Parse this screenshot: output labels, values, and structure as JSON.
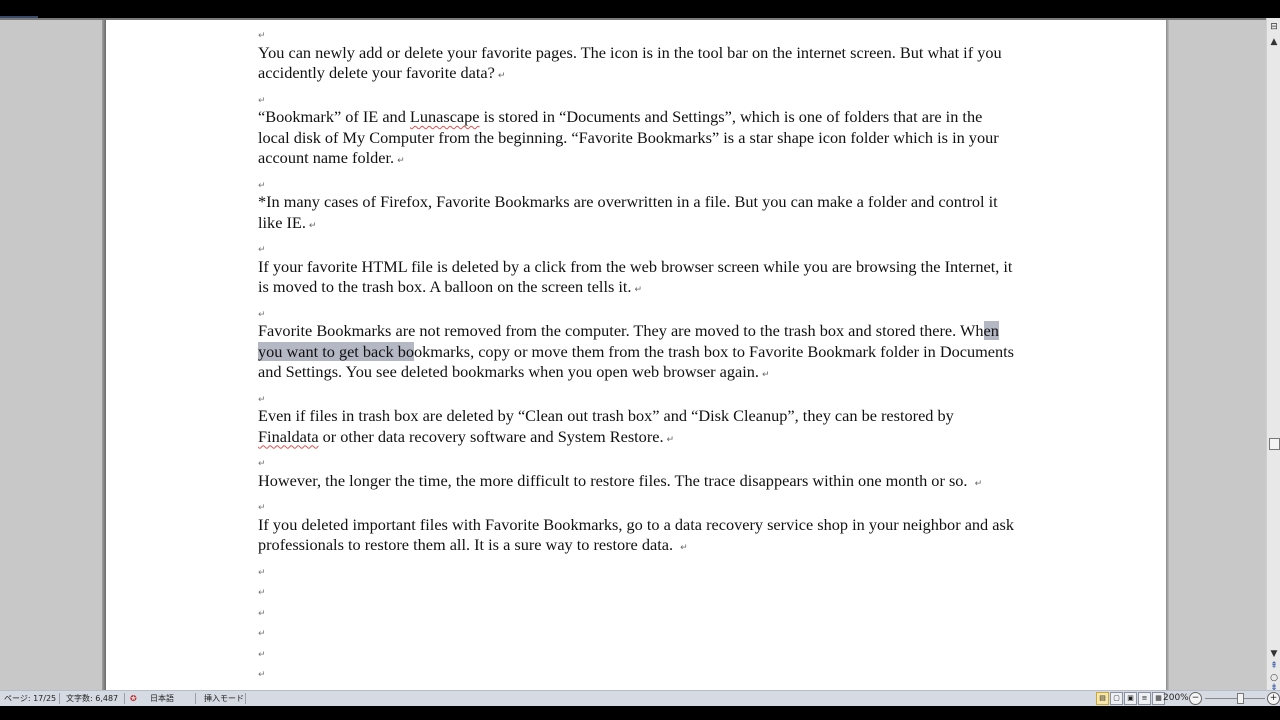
{
  "document": {
    "paragraph_mark": "↵",
    "paragraphs": [
      {
        "text": "You can newly add or delete your favorite pages.  The icon is  in the tool bar on the internet screen. But what if you accidently delete your favorite  data?"
      },
      {
        "pre": "“Bookmark” of IE and ",
        "misspelled": "Lunascape",
        "post": " is  stored in “Documents and Settings”, which is one of folders that are in the local disk of My Computer from the beginning.  “Favorite Bookmarks” is a star shape icon folder which is  in your account name folder."
      },
      {
        "text": "*In many cases of Firefox, Favorite Bookmarks are overwritten in a file.  But you can make a folder and control it like IE."
      },
      {
        "text": "If your favorite HTML file is deleted by a click from the web browser screen while you are browsing the Internet, it is moved to the trash box. A balloon on the screen tells it."
      },
      {
        "pre": "Favorite Bookmarks are not removed from the computer. They are moved to the trash box and stored there. Wh",
        "selected": "en you want to get back bo",
        "post": "okmarks, copy or move them from the trash box to Favorite Bookmark folder in Documents and Settings.  You see deleted bookmarks when you open web browser again."
      },
      {
        "pre": "Even if files  in trash box are deleted by “Clean out trash box” and “Disk Cleanup”, they can be restored by ",
        "misspelled": "Finaldata",
        "post": " or other data recovery software and System Restore."
      },
      {
        "text": "However, the longer the time, the more difficult to restore files.  The trace disappears within one month or so. "
      },
      {
        "text": "If you deleted important files with Favorite Bookmarks, go to a data recovery service shop in your neighbor and ask professionals to restore them all. It is a sure way to restore data. "
      }
    ]
  },
  "statusbar": {
    "page": "ページ: 17/25",
    "word_count": "文字数: 6,487",
    "language": "日本語",
    "insert_mode": "挿入モード",
    "zoom": "200%",
    "zoom_minus": "−",
    "zoom_plus": "+"
  },
  "scrollbar": {
    "split_icon": "⊟",
    "up_arrow": "▲",
    "down_arrow": "▼",
    "prev_page": "⇞",
    "browse_object": "○",
    "next_page": "⇟"
  },
  "view_buttons": [
    "▤",
    "▢",
    "▣",
    "≡",
    "▦"
  ]
}
